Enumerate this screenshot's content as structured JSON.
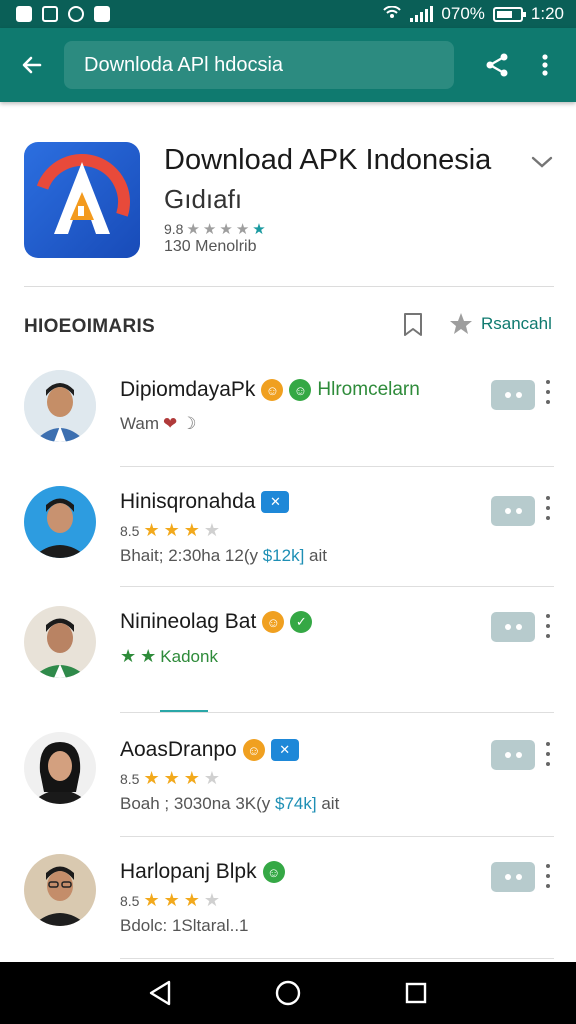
{
  "status_bar": {
    "battery": "070%",
    "time": "1:20",
    "icons": [
      "image-icon",
      "edit-icon",
      "clock-icon",
      "nfc-icon",
      "hotspot-icon",
      "signal-icon",
      "battery-icon"
    ]
  },
  "toolbar": {
    "search_text": "Downloda APl hdocsia",
    "colors": {
      "toolbar": "#0f7a6f",
      "status": "#0a5f57"
    }
  },
  "app": {
    "name": "Download APK Indonesia",
    "developer": "Gıdıafı",
    "rating_prefix": "9.8",
    "rating_stars": 4,
    "reviews": "130 Menolrib"
  },
  "section": {
    "title": "HIOEOIMARIS",
    "action_link": "Rsancahl"
  },
  "items": [
    {
      "name": "DipiomdayaPk",
      "tag": "Hlromcelarn",
      "subtitle": "Wam",
      "meta": ""
    },
    {
      "name": "Hinisqronahda",
      "rating_prefix": "8.5",
      "rating_stars": 3,
      "meta_prefix": "Bhait; 2:30ha 12(y",
      "meta_highlight": "$12k]",
      "meta_suffix": "ait"
    },
    {
      "name": "Niпineolag Bat",
      "subtitle": "Kadonk",
      "rating_stars": 2
    },
    {
      "name": "AoasDranpo",
      "rating_prefix": "8.5",
      "rating_stars": 3,
      "meta_prefix": "Boah ; 3030na 3K(y",
      "meta_highlight": "$74k]",
      "meta_suffix": "ait"
    },
    {
      "name": "Harlopanj Blpk",
      "rating_prefix": "8.5",
      "rating_stars": 3,
      "meta_prefix": "Bdolc: 1Sltaral..1"
    }
  ]
}
